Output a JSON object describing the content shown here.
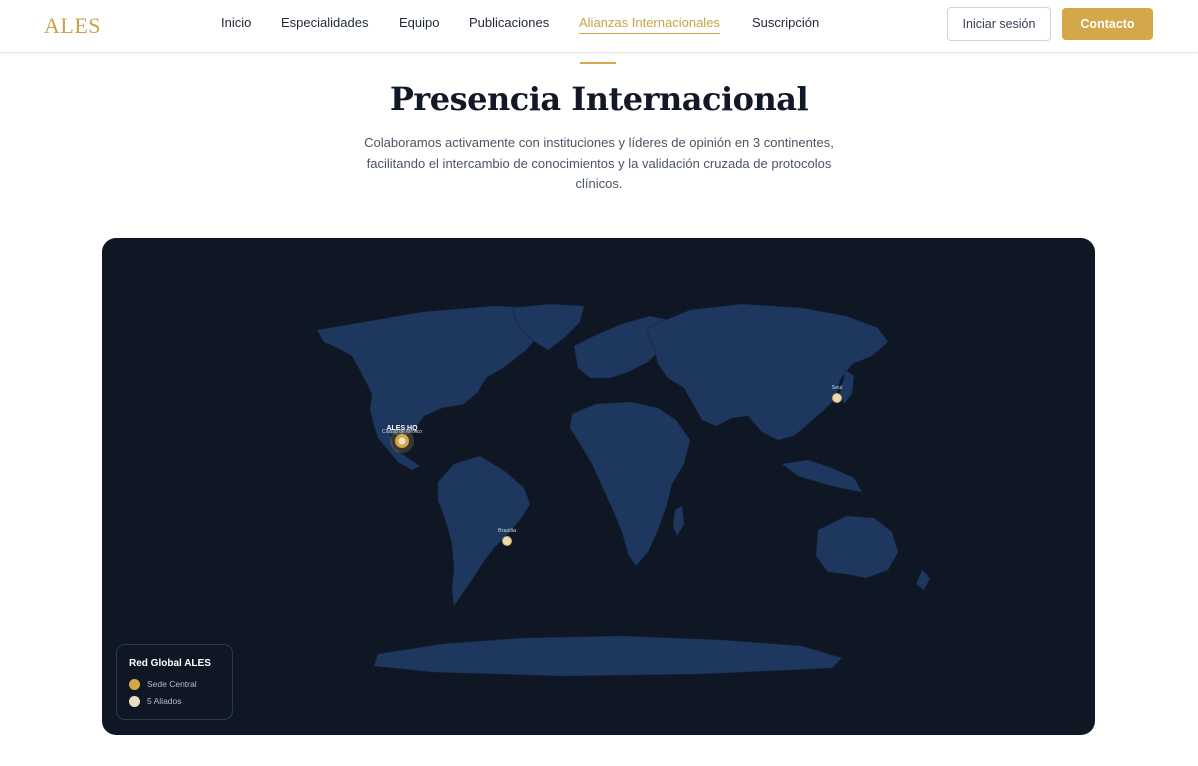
{
  "header": {
    "logo": "ALES",
    "nav": [
      {
        "label": "Inicio",
        "active": false
      },
      {
        "label": "Especialidades",
        "active": false
      },
      {
        "label": "Equipo",
        "active": false
      },
      {
        "label": "Publicaciones",
        "active": false
      },
      {
        "label": "Alianzas Internacionales",
        "active": true
      },
      {
        "label": "Suscripción",
        "active": false
      }
    ],
    "login_label": "Iniciar sesión",
    "contact_label": "Contacto"
  },
  "section": {
    "title": "Presencia Internacional",
    "subtitle": "Colaboramos activamente con instituciones y líderes de opinión en 3 continentes, facilitando el intercambio de conocimientos y la validación cruzada de protocolos clínicos."
  },
  "map": {
    "markers": [
      {
        "label": "ALES HQ",
        "sublabel": "Ciudad de México",
        "type": "hq"
      },
      {
        "label": "Seul",
        "type": "ally"
      },
      {
        "label": "Brasilia",
        "type": "ally"
      }
    ],
    "legend": {
      "title": "Red Global ALES",
      "hq_label": "Sede Central",
      "ally_label": "5 Aliados"
    }
  },
  "colors": {
    "accent": "#d4a74a",
    "map_background": "#0f1725",
    "land": "#1e375e",
    "ally_marker": "#e8dcc0"
  }
}
